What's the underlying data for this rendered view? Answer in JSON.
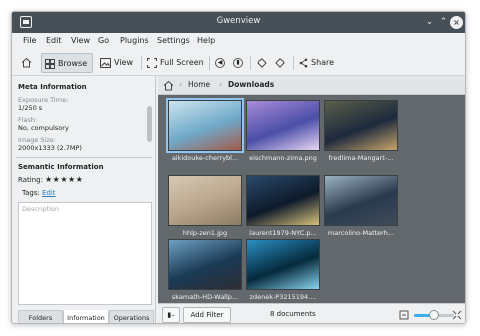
{
  "window": {
    "title": "Gwenview"
  },
  "menu": [
    "File",
    "Edit",
    "View",
    "Go",
    "Plugins",
    "Settings",
    "Help"
  ],
  "toolbar": {
    "browse": "Browse",
    "view": "View",
    "fullscreen": "Full Screen",
    "share": "Share"
  },
  "meta": {
    "heading": "Meta Information",
    "fields": [
      {
        "label": "Exposure Time:",
        "value": "1/250 s"
      },
      {
        "label": "Flash:",
        "value": "No, compulsory"
      },
      {
        "label": "Image Size:",
        "value": "2000x1333 (2.7MP)"
      }
    ]
  },
  "semantic": {
    "heading": "Semantic Information",
    "rating_label": "Rating:",
    "rating_stars": "★★★★★",
    "tags_label": "Tags:",
    "tags_edit": "Edit",
    "description_placeholder": "Description"
  },
  "sidebar_tabs": [
    "Folders",
    "Information",
    "Operations"
  ],
  "breadcrumb": {
    "home": "Home",
    "current": "Downloads"
  },
  "images": [
    {
      "name": "aikidouke-cherrybl...",
      "colors": [
        "#6fa9c9",
        "#cde4ef",
        "#a35a4a"
      ]
    },
    {
      "name": "eischmann-zima.png",
      "colors": [
        "#4b4fa8",
        "#a98bd8",
        "#e9d6f5"
      ]
    },
    {
      "name": "fredlima-Mangart-...",
      "colors": [
        "#1d2a3d",
        "#5b5f4a",
        "#c7a56a"
      ]
    },
    {
      "name": "hhlp-zen1.jpg",
      "colors": [
        "#b8a48a",
        "#d7c9b3",
        "#8b7a63"
      ]
    },
    {
      "name": "laurent1979-NYC.p...",
      "colors": [
        "#0e1a2b",
        "#2a4a6b",
        "#d9c27a"
      ]
    },
    {
      "name": "marcolino-Matterh...",
      "colors": [
        "#2a3a4e",
        "#9eb2c4",
        "#3f4d5a"
      ]
    },
    {
      "name": "skamath-HD-Wallp...",
      "colors": [
        "#1a3a55",
        "#6fa0c2",
        "#2e2e34"
      ]
    },
    {
      "name": "zdenek-P3215194....",
      "colors": [
        "#052a3d",
        "#2a8fc2",
        "#8ad3ee"
      ]
    }
  ],
  "status": {
    "add_filter": "Add Filter",
    "count": "8 documents",
    "zoom_fraction": 0.5
  },
  "colors": {
    "accent": "#3daee9",
    "titlebar": "#475057",
    "grid_bg": "#62686c"
  }
}
